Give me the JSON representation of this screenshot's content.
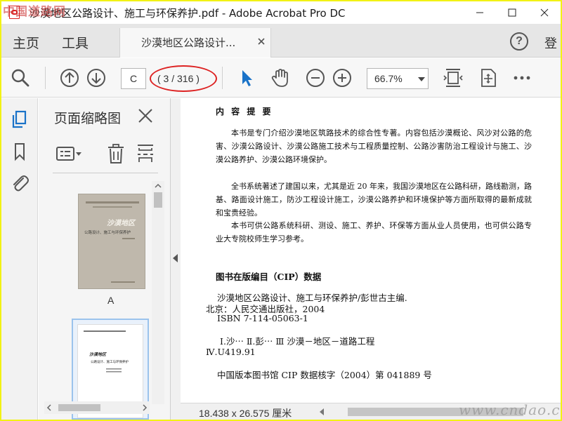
{
  "watermarks": {
    "top_left": "中国道路网",
    "bottom_right": "www.cndao.com"
  },
  "window": {
    "title": "沙漠地区公路设计、施工与环保养护.pdf - Adobe Acrobat Pro DC"
  },
  "tabbar": {
    "home_label": "主页",
    "tools_label": "工具",
    "doc_tab_label": "沙漠地区公路设计...",
    "help_symbol": "?",
    "login_label": "登"
  },
  "toolbar": {
    "page_input_value": "C",
    "page_count": "( 3 / 316 )",
    "zoom_value": "66.7%"
  },
  "thumbnails_panel": {
    "title": "页面缩略图",
    "pages": [
      {
        "label": "A",
        "cover_title": "沙漠地区",
        "cover_subtitle": "公路设计、施工与环保养护"
      },
      {
        "cover_title": "沙漠地区",
        "cover_subtitle": "公路设计、施工与环保养护"
      }
    ]
  },
  "document": {
    "summary_heading": "内 容 提 要",
    "paragraphs": [
      "本书是专门介绍沙漠地区筑路技术的综合性专著。内容包括沙漠概论、风沙对公路的危害、沙漠公路设计、沙漠公路施工技术与工程质量控制、公路沙害防治工程设计与施工、沙漠公路养护、沙漠公路环境保护。",
      "全书系统著述了建国以来，尤其是近 20 年来，我国沙漠地区在公路科研，路线勘测，路基、路面设计施工，防沙工程设计施工，沙漠公路养护和环境保护等方面所取得的最新成就和宝贵经验。",
      "本书可供公路系统科研、测设、施工、养护、环保等方面从业人员使用，也可供公路专业大专院校师生学习参考。"
    ],
    "cip_heading": "图书在版编目（CIP）数据",
    "cip_lines": [
      "沙漠地区公路设计、施工与环保养护/彭世古主编.",
      "北京：人民交通出版社，2004",
      "ISBN 7-114-05063-1",
      "Ⅰ.沙⋯   Ⅱ.彭⋯   Ⅲ  沙漠－地区－道路工程",
      "Ⅳ.U419.91",
      "中国版本图书馆 CIP 数据核字（2004）第 041889 号"
    ]
  },
  "statusbar": {
    "page_size": "18.438 x 26.575 厘米"
  },
  "colors": {
    "accent_blue": "#1a73c8",
    "annotation_red": "#dd2222",
    "frame_yellow": "#f2f214"
  }
}
